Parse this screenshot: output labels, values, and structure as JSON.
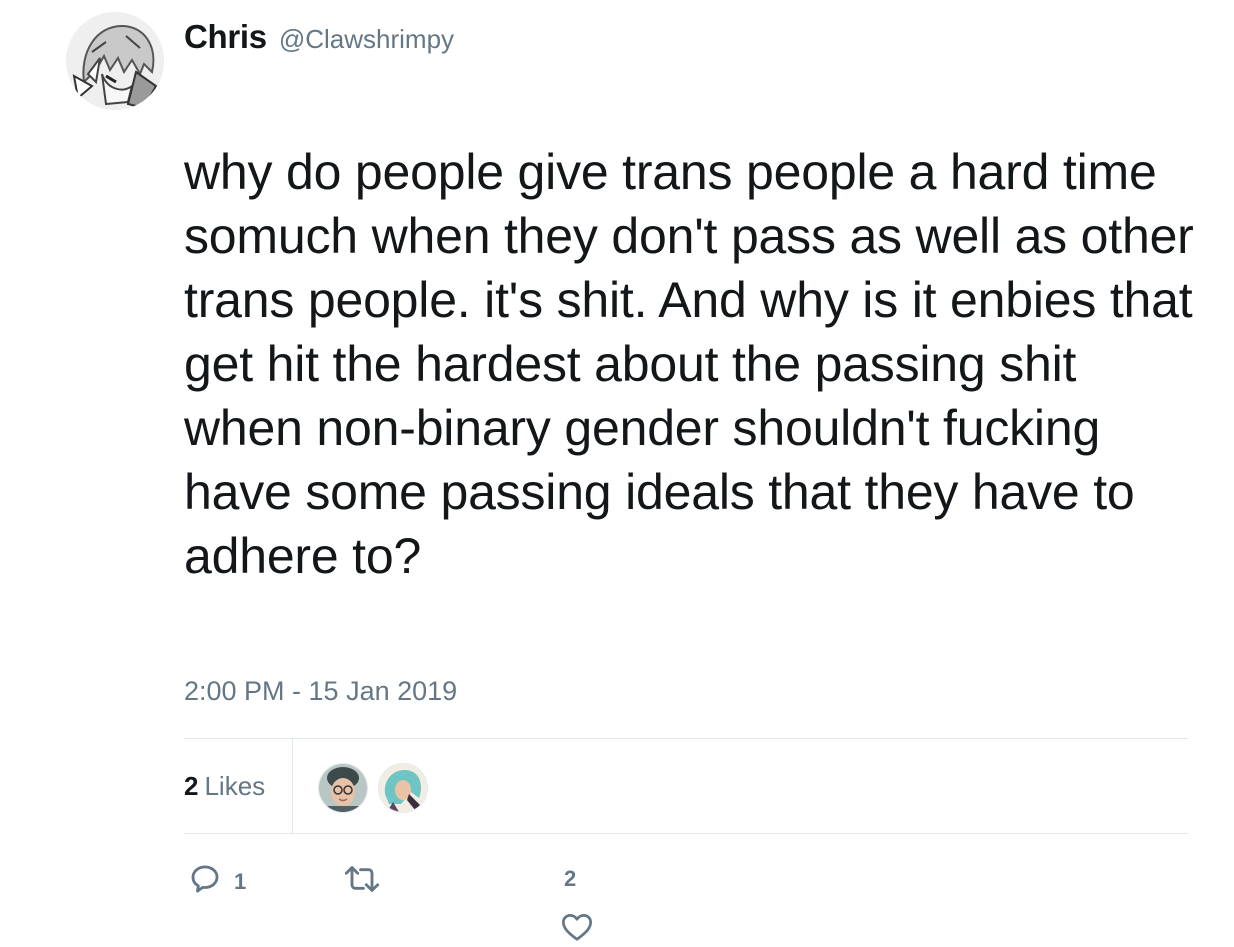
{
  "tweet": {
    "author_name": "Chris",
    "author_handle": "@Clawshrimpy",
    "text": "why do people give trans people a hard time somuch when they don't pass as well as other trans people. it's shit. And why is it enbies that get hit the hardest about the passing shit when non-binary gender shouldn't fucking have some passing ideals that they have to adhere to?",
    "timestamp": "2:00 PM - 15 Jan 2019"
  },
  "stats": {
    "likes_count": "2",
    "likes_label": "Likes"
  },
  "actions": {
    "reply_count": "1",
    "retweet_count": "",
    "like_count": "2"
  },
  "icons": {
    "reply": "reply-bubble-icon",
    "retweet": "retweet-arrows-icon",
    "like": "heart-icon"
  },
  "colors": {
    "text_primary": "#14171a",
    "text_secondary": "#657786",
    "divider": "#e1e8ed"
  }
}
